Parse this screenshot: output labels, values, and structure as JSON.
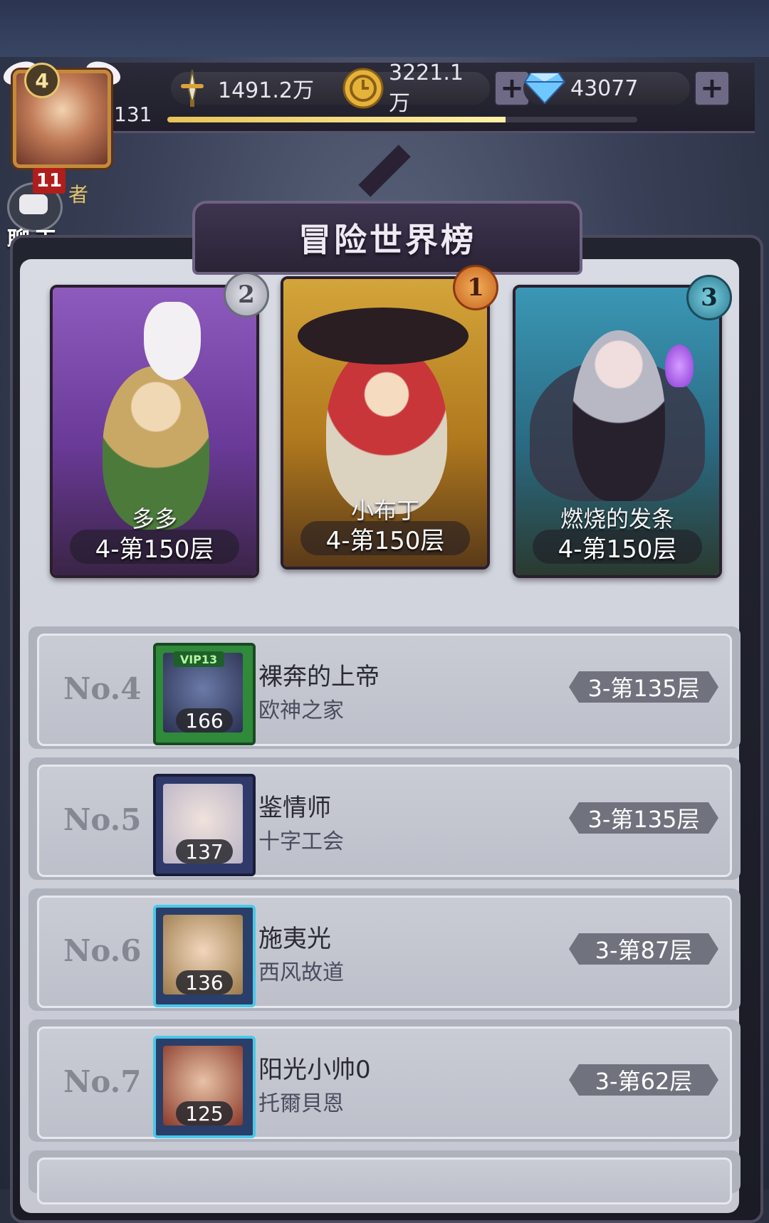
{
  "player": {
    "avatar_level": "4",
    "level": "131",
    "xp_fraction": 0.72
  },
  "resources": {
    "power": "1491.2万",
    "gold": "3221.1万",
    "diamonds": "43077"
  },
  "chat": {
    "badge": "11",
    "label": "聊天",
    "side_text": "者"
  },
  "title": "冒险世界榜",
  "top3": [
    {
      "rank": "2",
      "name": "多多",
      "floor": "4-第150层"
    },
    {
      "rank": "1",
      "name": "小布丁",
      "floor": "4-第150层"
    },
    {
      "rank": "3",
      "name": "燃烧的发条",
      "floor": "4-第150层"
    }
  ],
  "rows": [
    {
      "no": "No.4",
      "name": "裸奔的上帝",
      "guild": "欧神之家",
      "level": "166",
      "floor": "3-第135层",
      "vip": "VIP13"
    },
    {
      "no": "No.5",
      "name": "鉴情师",
      "guild": "十字工会",
      "level": "137",
      "floor": "3-第135层"
    },
    {
      "no": "No.6",
      "name": "施夷光",
      "guild": "西风故道",
      "level": "136",
      "floor": "3-第87层"
    },
    {
      "no": "No.7",
      "name": "阳光小帅0",
      "guild": "托爾貝恩",
      "level": "125",
      "floor": "3-第62层"
    }
  ],
  "colors": {
    "accent_gold": "#e7c457",
    "panel_inner": "#d0d3dc",
    "card_purple": "#7b4aa8",
    "card_gold": "#c9902a",
    "card_teal": "#2b7f9a"
  }
}
